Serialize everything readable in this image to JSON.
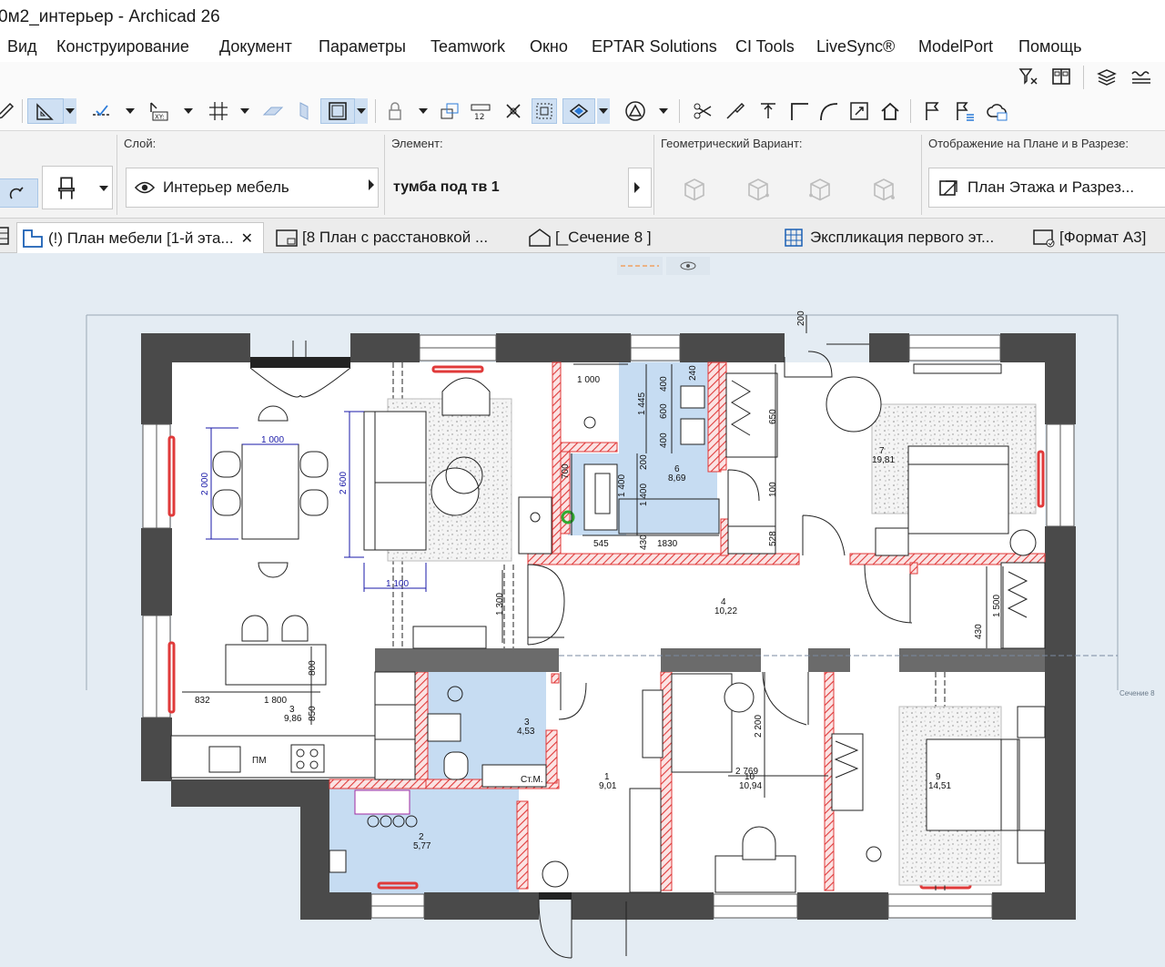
{
  "window": {
    "title": "0м2_интерьер - Archicad 26"
  },
  "menu": [
    "Вид",
    "Конструирование",
    "Документ",
    "Параметры",
    "Teamwork",
    "Окно",
    "EPTAR Solutions",
    "CI Tools",
    "LiveSync®",
    "ModelPort",
    "Помощь"
  ],
  "infobox": {
    "layer_label": "Слой:",
    "layer_value": "Интерьер мебель",
    "element_label": "Элемент:",
    "element_value": "тумба под тв 1",
    "geometry_label": "Геометрический Вариант:",
    "display_label": "Отображение на Плане и в Разрезе:",
    "display_value": "План Этажа и Разрез..."
  },
  "tabs": [
    {
      "label": "(!) План мебели [1-й эта...",
      "active": true,
      "close": "✕"
    },
    {
      "label": "[8 План с расстановкой ...",
      "active": false
    },
    {
      "label": "[_Сечение 8 ]",
      "active": false
    },
    {
      "label": "Экспликация первого эт...",
      "active": false
    },
    {
      "label": "[Формат А3]",
      "active": false
    }
  ],
  "colors": {
    "wall": "#4a4a4a",
    "accent_red": "#e03a3a",
    "canvas": "#e4ecf3",
    "wet_zone": "#c6dcf2",
    "dim_blue": "#1a1aa8"
  },
  "plan": {
    "rooms": [
      {
        "num": "7",
        "area": "19,81"
      },
      {
        "num": "6",
        "area": "8,69"
      },
      {
        "num": "4",
        "area": "10,22"
      },
      {
        "num": "3",
        "area": "9,86"
      },
      {
        "num": "3",
        "area": "4,53"
      },
      {
        "num": "1",
        "area": "9,01"
      },
      {
        "num": "2",
        "area": "5,77"
      },
      {
        "num": "10",
        "area": "10,94"
      },
      {
        "num": "9",
        "area": "14,51"
      }
    ],
    "dims": [
      "200",
      "1 000",
      "240",
      "1 445",
      "400",
      "600",
      "400",
      "650",
      "200",
      "700",
      "1 400",
      "1 400",
      "545",
      "430",
      "1830",
      "100",
      "528",
      "1 000",
      "2 000",
      "2 600",
      "1 100",
      "1 300",
      "1 500",
      "430",
      "800",
      "832",
      "1 800",
      "850",
      "2 200",
      "2 769"
    ],
    "labels": {
      "sink": "ПМ",
      "washer": "Ст.М.",
      "section": "Сечение 8"
    }
  }
}
